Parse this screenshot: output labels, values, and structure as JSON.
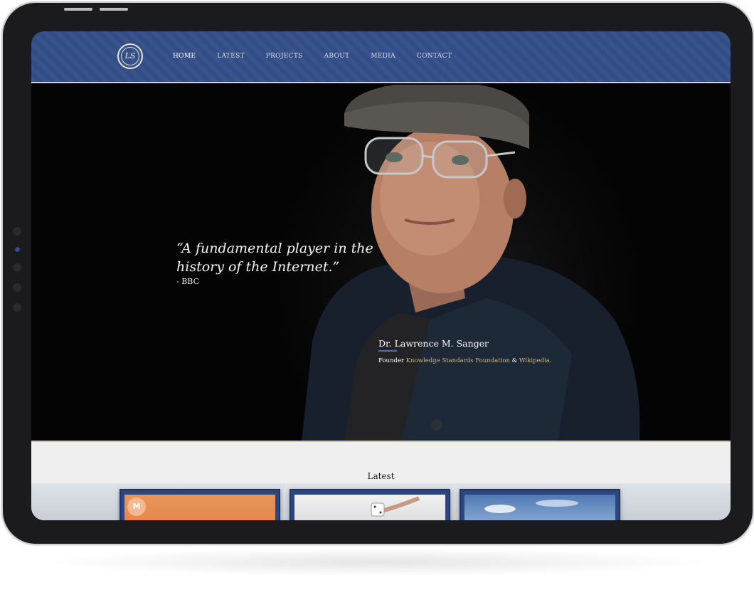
{
  "site": {
    "logo_text": "LS",
    "nav": [
      {
        "label": "HOME",
        "active": true
      },
      {
        "label": "LATEST",
        "active": false
      },
      {
        "label": "PROJECTS",
        "active": false
      },
      {
        "label": "ABOUT",
        "active": false
      },
      {
        "label": "MEDIA",
        "active": false
      },
      {
        "label": "CONTACT",
        "active": false
      }
    ]
  },
  "hero": {
    "quote": "“A fundamental player in the history of the Internet.”",
    "quote_source": "- BBC",
    "name": "Dr. Lawrence M. Sanger",
    "founder_prefix": "Founder",
    "founder_link1": "Knowledge Standards Foundation",
    "founder_amp": "&",
    "founder_link2": "Wikipedia",
    "founder_suffix": "."
  },
  "latest": {
    "title": "Latest",
    "cards": [
      {
        "badge": "M"
      },
      {
        "badge": ""
      },
      {
        "badge": ""
      }
    ]
  },
  "colors": {
    "nav_bg": "#34508a",
    "accent_rule": "#4d6fb8",
    "link": "#c9b98f",
    "card_frame": "#2c4680"
  }
}
